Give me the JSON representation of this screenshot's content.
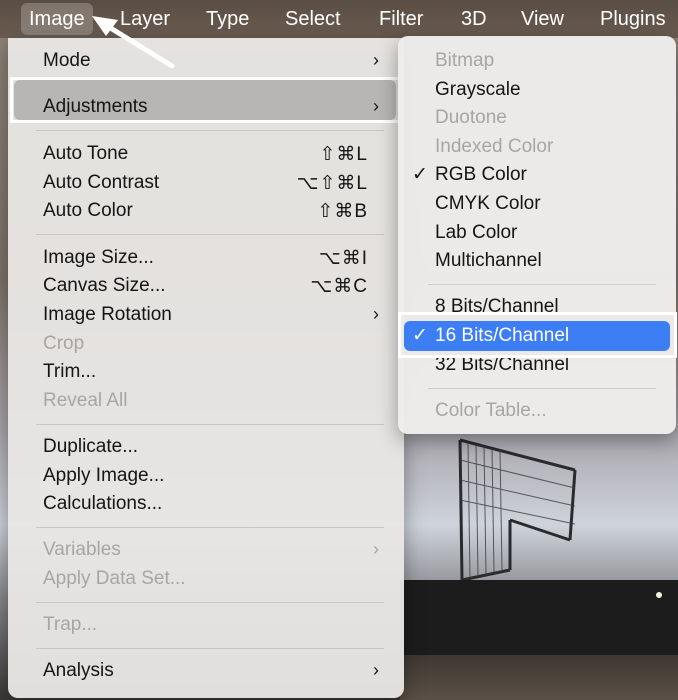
{
  "menubar": {
    "items": [
      {
        "label": "Image"
      },
      {
        "label": "Layer"
      },
      {
        "label": "Type"
      },
      {
        "label": "Select"
      },
      {
        "label": "Filter"
      },
      {
        "label": "3D"
      },
      {
        "label": "View"
      },
      {
        "label": "Plugins"
      }
    ]
  },
  "image_menu": {
    "mode": "Mode",
    "adjustments": "Adjustments",
    "auto_tone": {
      "label": "Auto Tone",
      "shortcut": "⇧⌘L"
    },
    "auto_contrast": {
      "label": "Auto Contrast",
      "shortcut": "⌥⇧⌘L"
    },
    "auto_color": {
      "label": "Auto Color",
      "shortcut": "⇧⌘B"
    },
    "image_size": {
      "label": "Image Size...",
      "shortcut": "⌥⌘I"
    },
    "canvas_size": {
      "label": "Canvas Size...",
      "shortcut": "⌥⌘C"
    },
    "image_rotation": "Image Rotation",
    "crop": "Crop",
    "trim": "Trim...",
    "reveal_all": "Reveal All",
    "duplicate": "Duplicate...",
    "apply_image": "Apply Image...",
    "calculations": "Calculations...",
    "variables": "Variables",
    "apply_data_set": "Apply Data Set...",
    "trap": "Trap...",
    "analysis": "Analysis",
    "chevron": "›"
  },
  "mode_submenu": {
    "bitmap": "Bitmap",
    "grayscale": "Grayscale",
    "duotone": "Duotone",
    "indexed_color": "Indexed Color",
    "rgb_color": "RGB Color",
    "cmyk_color": "CMYK Color",
    "lab_color": "Lab Color",
    "multichannel": "Multichannel",
    "bits_8": "8 Bits/Channel",
    "bits_16": "16 Bits/Channel",
    "bits_32": "32 Bits/Channel",
    "color_table": "Color Table...",
    "checkmark": "✓"
  },
  "colors": {
    "selection": "#3d7ef5",
    "menu_bg": "#e8e6e4",
    "disabled_text": "#a8a6a4"
  }
}
